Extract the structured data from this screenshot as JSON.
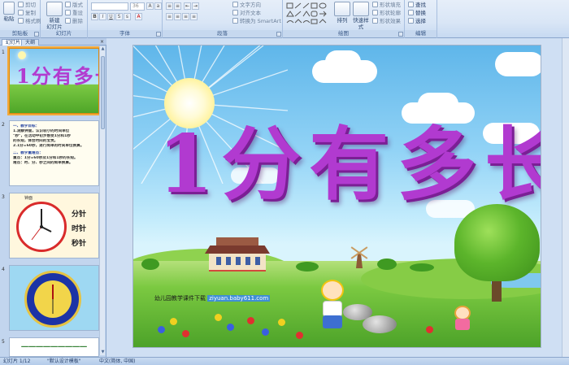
{
  "ribbon": {
    "clipboard": {
      "paste": "粘贴",
      "cut": "剪切",
      "copy": "复制",
      "format_painter": "格式刷",
      "label": "剪贴板"
    },
    "slides": {
      "new_slide": "新建\n幻灯片",
      "layout": "版式",
      "reset": "重设",
      "delete": "删除",
      "label": "幻灯片"
    },
    "font": {
      "font_name": "",
      "font_size": "36",
      "label": "字体"
    },
    "paragraph": {
      "text_direction": "文字方向",
      "align_text": "对齐文本",
      "smartart": "转换为 SmartArt",
      "label": "段落"
    },
    "drawing": {
      "arrange": "排列",
      "quick_styles": "快速样式",
      "shape_fill": "形状填充",
      "shape_outline": "形状轮廓",
      "shape_effects": "形状效果",
      "label": "绘图"
    },
    "editing": {
      "find": "查找",
      "replace": "替换",
      "select": "选择",
      "label": "编辑"
    }
  },
  "left_pane": {
    "tab_slides": "幻灯片",
    "tab_outline": "大纲",
    "close": "×",
    "thumbnails": [
      {
        "num": "1",
        "title": "1分有多长"
      },
      {
        "num": "2",
        "lines": [
          "一、教学目标：",
          "1.观察钟面，认识较小的时间单位",
          "\"秒\"，在活动中初步感受1分和1秒",
          "的长短，体会时间的宝贵。",
          "2.1分=60秒，进行简单的时间单位换算。",
          "二、教学重难点：",
          "重点：1分=60秒及1分和1秒的长短。",
          "难点：时、分、秒之间的简单换算。"
        ]
      },
      {
        "num": "3",
        "heading": "钟面",
        "labels": [
          "分针",
          "时针",
          "秒针"
        ]
      },
      {
        "num": "4"
      },
      {
        "num": "5",
        "text": "一一一一一一一一一"
      }
    ]
  },
  "slide": {
    "title": "1分有多长",
    "watermark_text": "幼儿园教学课件下载",
    "watermark_url": "ziyuan.baby611.com"
  },
  "statusbar": {
    "slide_count": "幻灯片 1/12",
    "theme": "\"默认设计模板\"",
    "language": "中文(简体, 中国)"
  }
}
